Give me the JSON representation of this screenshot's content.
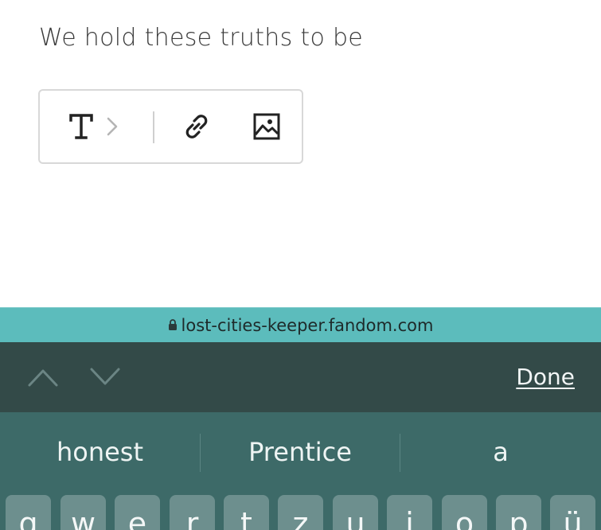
{
  "editor": {
    "text": "We hold these truths to be"
  },
  "toolbar": {
    "text_icon": "text-format-icon",
    "chevron_icon": "chevron-right-icon",
    "link_icon": "link-icon",
    "image_icon": "image-icon"
  },
  "url_bar": {
    "lock_icon": "lock-icon",
    "domain": "lost-cities-keeper.fandom.com"
  },
  "accessory": {
    "prev_icon": "chevron-up-icon",
    "next_icon": "chevron-down-icon",
    "done_label": "Done"
  },
  "keyboard": {
    "suggestions": [
      "honest",
      "Prentice",
      "a"
    ],
    "keys": [
      "q",
      "w",
      "e",
      "r",
      "t",
      "z",
      "u",
      "i",
      "o",
      "p",
      "ü"
    ]
  },
  "colors": {
    "url_bar": "#5cbcbc",
    "accessory": "#334a48",
    "keyboard": "#3d6a68",
    "key": "#6d8f8e"
  }
}
